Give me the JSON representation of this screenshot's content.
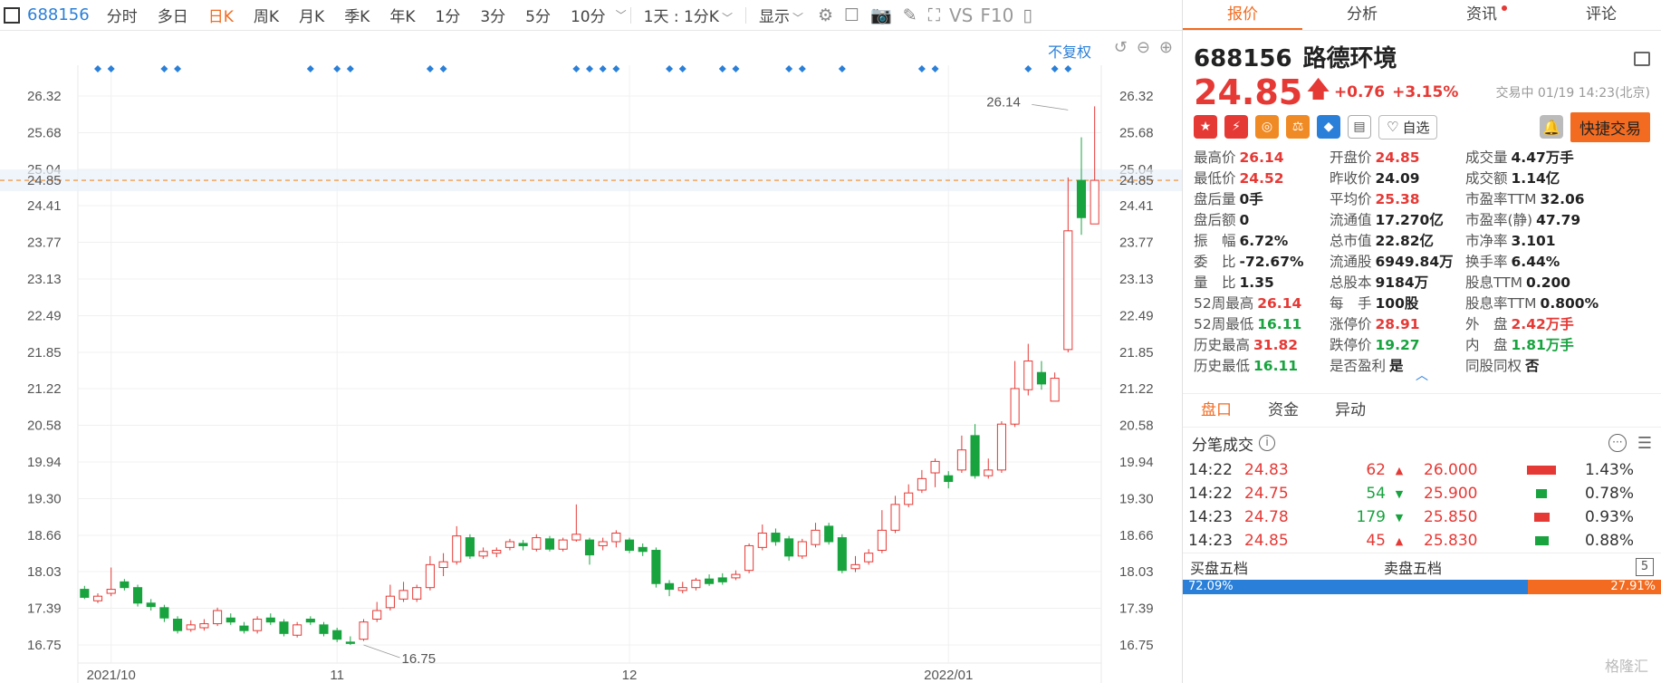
{
  "toolbar": {
    "code": "688156",
    "periods": [
      "分时",
      "多日",
      "日K",
      "周K",
      "月K",
      "季K",
      "年K",
      "1分",
      "3分",
      "5分",
      "10分"
    ],
    "active_period": "日K",
    "interval_dropdown": "1天 : 1分K",
    "display_dropdown": "显示",
    "vs": "VS",
    "f10": "F10"
  },
  "chart": {
    "restore_label": "不复权",
    "high_label": "26.14",
    "low_label": "16.75",
    "current_price_label": "24.85",
    "colors": {
      "up": "#e53935",
      "down": "#18a33f",
      "marker": "#2a7fd8",
      "price_line": "#f08a24"
    }
  },
  "chart_data": {
    "type": "candlestick",
    "y_ticks": [
      "26.32",
      "25.68",
      "25.04",
      "24.41",
      "23.77",
      "23.13",
      "22.49",
      "21.85",
      "21.22",
      "20.58",
      "19.94",
      "19.30",
      "18.66",
      "18.03",
      "17.39",
      "16.75"
    ],
    "ylim": [
      16.75,
      26.32
    ],
    "x_labels": [
      {
        "label": "2021/10",
        "index": 2
      },
      {
        "label": "11",
        "index": 19
      },
      {
        "label": "12",
        "index": 41
      },
      {
        "label": "2022/01",
        "index": 65
      }
    ],
    "current_price": 24.85,
    "annotations": [
      {
        "label": "26.14",
        "index": 74
      },
      {
        "label": "16.75",
        "index": 21
      }
    ],
    "marker_indices": [
      1,
      2,
      6,
      7,
      17,
      19,
      20,
      26,
      27,
      37,
      38,
      39,
      40,
      44,
      45,
      48,
      49,
      53,
      54,
      57,
      63,
      64,
      71,
      73,
      74
    ],
    "candles": [
      [
        17.72,
        17.58,
        17.78,
        17.55
      ],
      [
        17.52,
        17.6,
        17.65,
        17.48
      ],
      [
        17.65,
        17.72,
        18.1,
        17.6
      ],
      [
        17.85,
        17.75,
        17.9,
        17.7
      ],
      [
        17.75,
        17.48,
        17.8,
        17.42
      ],
      [
        17.48,
        17.42,
        17.55,
        17.35
      ],
      [
        17.4,
        17.22,
        17.45,
        17.15
      ],
      [
        17.2,
        17.0,
        17.25,
        16.95
      ],
      [
        17.02,
        17.1,
        17.18,
        16.98
      ],
      [
        17.05,
        17.12,
        17.2,
        17.0
      ],
      [
        17.12,
        17.35,
        17.4,
        17.08
      ],
      [
        17.22,
        17.15,
        17.3,
        17.1
      ],
      [
        17.08,
        17.0,
        17.15,
        16.95
      ],
      [
        17.0,
        17.2,
        17.25,
        16.95
      ],
      [
        17.22,
        17.15,
        17.3,
        17.1
      ],
      [
        17.15,
        16.95,
        17.2,
        16.9
      ],
      [
        16.92,
        17.1,
        17.15,
        16.88
      ],
      [
        17.2,
        17.15,
        17.25,
        17.1
      ],
      [
        17.1,
        16.95,
        17.15,
        16.9
      ],
      [
        17.0,
        16.85,
        17.05,
        16.8
      ],
      [
        16.8,
        16.78,
        16.9,
        16.75
      ],
      [
        16.85,
        17.15,
        17.2,
        16.82
      ],
      [
        17.2,
        17.35,
        17.5,
        17.15
      ],
      [
        17.4,
        17.6,
        17.8,
        17.35
      ],
      [
        17.55,
        17.7,
        17.85,
        17.5
      ],
      [
        17.55,
        17.75,
        17.8,
        17.5
      ],
      [
        17.75,
        18.15,
        18.3,
        17.7
      ],
      [
        18.1,
        18.2,
        18.35,
        17.95
      ],
      [
        18.2,
        18.65,
        18.82,
        18.15
      ],
      [
        18.62,
        18.3,
        18.68,
        18.25
      ],
      [
        18.3,
        18.38,
        18.45,
        18.25
      ],
      [
        18.35,
        18.4,
        18.45,
        18.28
      ],
      [
        18.45,
        18.55,
        18.6,
        18.4
      ],
      [
        18.52,
        18.48,
        18.58,
        18.4
      ],
      [
        18.42,
        18.62,
        18.68,
        18.38
      ],
      [
        18.6,
        18.42,
        18.65,
        18.38
      ],
      [
        18.42,
        18.58,
        18.62,
        18.38
      ],
      [
        18.58,
        18.68,
        19.2,
        18.55
      ],
      [
        18.58,
        18.32,
        18.62,
        18.15
      ],
      [
        18.48,
        18.55,
        18.62,
        18.4
      ],
      [
        18.55,
        18.7,
        18.75,
        18.45
      ],
      [
        18.58,
        18.4,
        18.62,
        18.35
      ],
      [
        18.45,
        18.38,
        18.52,
        18.3
      ],
      [
        18.4,
        17.82,
        18.45,
        17.75
      ],
      [
        17.82,
        17.72,
        17.88,
        17.6
      ],
      [
        17.7,
        17.75,
        17.85,
        17.65
      ],
      [
        17.75,
        17.88,
        17.92,
        17.7
      ],
      [
        17.9,
        17.82,
        17.98,
        17.78
      ],
      [
        17.92,
        17.85,
        18.0,
        17.8
      ],
      [
        17.92,
        17.98,
        18.05,
        17.88
      ],
      [
        18.05,
        18.48,
        18.52,
        18.0
      ],
      [
        18.45,
        18.7,
        18.85,
        18.4
      ],
      [
        18.7,
        18.55,
        18.78,
        18.48
      ],
      [
        18.6,
        18.3,
        18.65,
        18.22
      ],
      [
        18.3,
        18.55,
        18.6,
        18.25
      ],
      [
        18.5,
        18.75,
        18.88,
        18.45
      ],
      [
        18.82,
        18.55,
        18.88,
        18.5
      ],
      [
        18.62,
        18.05,
        18.68,
        18.0
      ],
      [
        18.08,
        18.15,
        18.3,
        18.02
      ],
      [
        18.2,
        18.35,
        18.42,
        18.15
      ],
      [
        18.4,
        18.75,
        19.1,
        18.35
      ],
      [
        18.75,
        19.2,
        19.35,
        18.7
      ],
      [
        19.2,
        19.4,
        19.55,
        19.15
      ],
      [
        19.45,
        19.65,
        19.8,
        19.4
      ],
      [
        19.75,
        19.95,
        20.0,
        19.5
      ],
      [
        19.7,
        19.6,
        19.78,
        19.48
      ],
      [
        19.8,
        20.15,
        20.4,
        19.75
      ],
      [
        20.4,
        19.7,
        20.6,
        19.65
      ],
      [
        19.7,
        19.8,
        20.0,
        19.65
      ],
      [
        19.8,
        20.6,
        20.65,
        19.75
      ],
      [
        20.6,
        21.22,
        21.7,
        20.55
      ],
      [
        21.2,
        21.7,
        22.0,
        21.1
      ],
      [
        21.5,
        21.3,
        21.7,
        21.2
      ],
      [
        21.0,
        21.4,
        21.5,
        21.1
      ],
      [
        21.9,
        23.97,
        24.9,
        21.85
      ],
      [
        24.85,
        24.2,
        25.6,
        23.9
      ],
      [
        24.09,
        24.85,
        26.14,
        24.52
      ]
    ]
  },
  "panel": {
    "tabs": [
      "报价",
      "分析",
      "资讯",
      "评论"
    ],
    "active_tab": "报价",
    "stock_code": "688156",
    "stock_name": "路德环境",
    "price": "24.85",
    "change": "+0.76",
    "change_pct": "+3.15%",
    "trade_time": "交易中 01/19 14:23(北京)",
    "fav_label": "自选",
    "quick_trade": "快捷交易",
    "stats": [
      {
        "k": "最高价",
        "v": "26.14",
        "c": "red"
      },
      {
        "k": "开盘价",
        "v": "24.85",
        "c": "red"
      },
      {
        "k": "成交量",
        "v": "4.47万手",
        "c": ""
      },
      {
        "k": "最低价",
        "v": "24.52",
        "c": "red"
      },
      {
        "k": "昨收价",
        "v": "24.09",
        "c": ""
      },
      {
        "k": "成交额",
        "v": "1.14亿",
        "c": ""
      },
      {
        "k": "盘后量",
        "v": "0手",
        "c": ""
      },
      {
        "k": "平均价",
        "v": "25.38",
        "c": "red"
      },
      {
        "k": "市盈率TTM",
        "v": "32.06",
        "c": ""
      },
      {
        "k": "盘后额",
        "v": "0",
        "c": ""
      },
      {
        "k": "流通值",
        "v": "17.270亿",
        "c": ""
      },
      {
        "k": "市盈率(静)",
        "v": "47.79",
        "c": ""
      },
      {
        "k": "振　幅",
        "v": "6.72%",
        "c": ""
      },
      {
        "k": "总市值",
        "v": "22.82亿",
        "c": ""
      },
      {
        "k": "市净率",
        "v": "3.101",
        "c": ""
      },
      {
        "k": "委　比",
        "v": "-72.67%",
        "c": ""
      },
      {
        "k": "流通股",
        "v": "6949.84万",
        "c": ""
      },
      {
        "k": "换手率",
        "v": "6.44%",
        "c": ""
      },
      {
        "k": "量　比",
        "v": "1.35",
        "c": ""
      },
      {
        "k": "总股本",
        "v": "9184万",
        "c": ""
      },
      {
        "k": "股息TTM",
        "v": "0.200",
        "c": ""
      },
      {
        "k": "52周最高",
        "v": "26.14",
        "c": "red"
      },
      {
        "k": "每　手",
        "v": "100股",
        "c": ""
      },
      {
        "k": "股息率TTM",
        "v": "0.800%",
        "c": ""
      },
      {
        "k": "52周最低",
        "v": "16.11",
        "c": "green"
      },
      {
        "k": "涨停价",
        "v": "28.91",
        "c": "red"
      },
      {
        "k": "外　盘",
        "v": "2.42万手",
        "c": "red"
      },
      {
        "k": "历史最高",
        "v": "31.82",
        "c": "red"
      },
      {
        "k": "跌停价",
        "v": "19.27",
        "c": "green"
      },
      {
        "k": "内　盘",
        "v": "1.81万手",
        "c": "green"
      },
      {
        "k": "历史最低",
        "v": "16.11",
        "c": "green"
      },
      {
        "k": "是否盈利",
        "v": "是",
        "c": ""
      },
      {
        "k": "同股同权",
        "v": "否",
        "c": ""
      }
    ],
    "subtabs": [
      "盘口",
      "资金",
      "异动"
    ],
    "active_subtab": "盘口",
    "ticks_title": "分笔成交",
    "ticks": [
      {
        "t": "14:22",
        "p": "24.83",
        "v": "62",
        "d": "up",
        "lv": "26.000",
        "bar": 0.38,
        "bc": "#e53935",
        "pct": "1.43%"
      },
      {
        "t": "14:22",
        "p": "24.75",
        "v": "54",
        "d": "down",
        "lv": "25.900",
        "bar": 0.14,
        "bc": "#18a33f",
        "pct": "0.78%"
      },
      {
        "t": "14:23",
        "p": "24.78",
        "v": "179",
        "d": "down",
        "lv": "25.850",
        "bar": 0.2,
        "bc": "#e53935",
        "pct": "0.93%"
      },
      {
        "t": "14:23",
        "p": "24.85",
        "v": "45",
        "d": "up",
        "lv": "25.830",
        "bar": 0.18,
        "bc": "#18a33f",
        "pct": "0.88%"
      }
    ],
    "buy5": "买盘五档",
    "sell5": "卖盘五档",
    "buy_ratio": "72.09%",
    "sell_ratio": "27.91%",
    "buy_ratio_value": 72.09,
    "watermark": "格隆汇"
  }
}
